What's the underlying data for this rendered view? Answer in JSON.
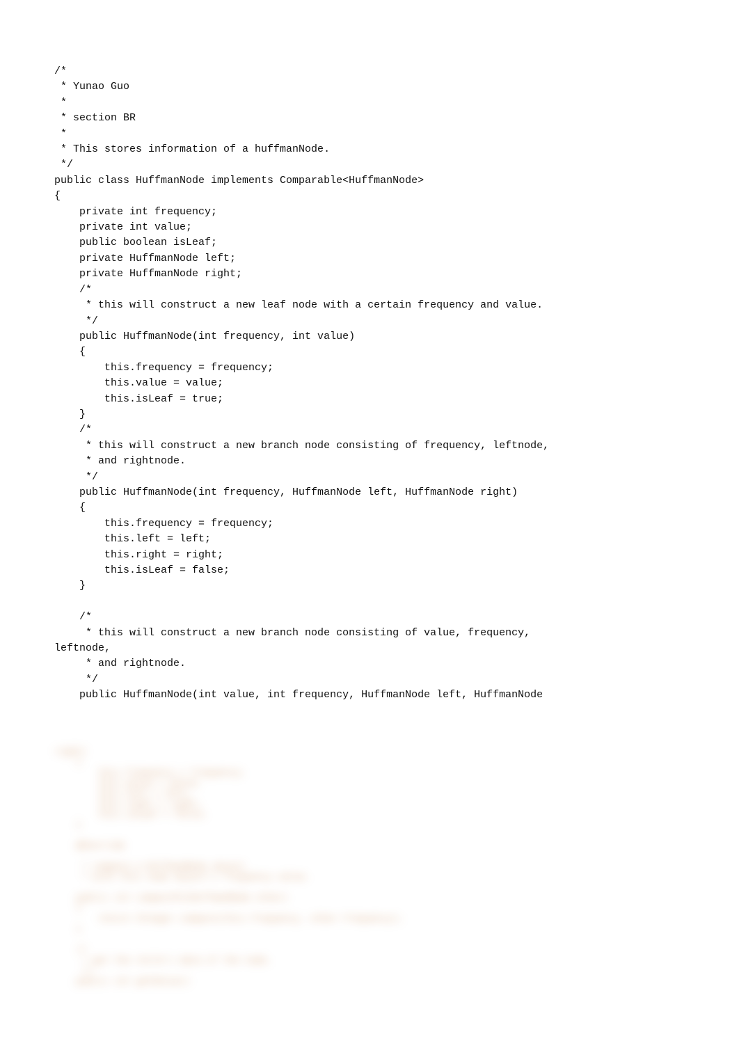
{
  "code_visible": "/*\n * Yunao Guo\n *\n * section BR\n *\n * This stores information of a huffmanNode.\n */\npublic class HuffmanNode implements Comparable<HuffmanNode>\n{\n    private int frequency;\n    private int value;\n    public boolean isLeaf;\n    private HuffmanNode left;\n    private HuffmanNode right;\n    /*\n     * this will construct a new leaf node with a certain frequency and value.\n     */\n    public HuffmanNode(int frequency, int value)\n    {\n        this.frequency = frequency;\n        this.value = value;\n        this.isLeaf = true;\n    }\n    /*\n     * this will construct a new branch node consisting of frequency, leftnode,\n     * and rightnode.\n     */\n    public HuffmanNode(int frequency, HuffmanNode left, HuffmanNode right)\n    {\n        this.frequency = frequency;\n        this.left = left;\n        this.right = right;\n        this.isLeaf = false;\n    }\n\n    /*\n     * this will construct a new branch node consisting of value, frequency,\nleftnode,\n     * and rightnode.\n     */\n    public HuffmanNode(int value, int frequency, HuffmanNode left, HuffmanNode",
  "code_blurred": "right)\n    {\n        this.frequency = frequency;\n        this.value = value;\n        this.left = left;\n        this.right = right;\n        this.isLeaf = false;\n    }\n\n    @Override\n\n     * compare a HuffmanNode object\n     * with this node object's frequency value.\n\n    public int compareTo(HuffmanNode other)\n    {\n        return Integer.compare(this.frequency, other.frequency);\n    }\n\n    /*\n     * get the child's data of the node.\n     */\n    public int getValue()"
}
